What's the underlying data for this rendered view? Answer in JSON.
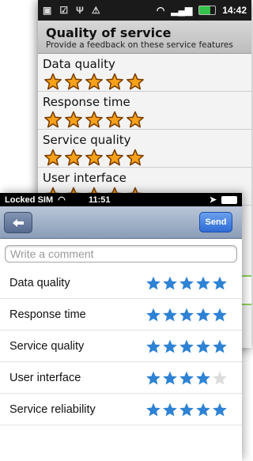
{
  "android": {
    "status": {
      "time": "14:42"
    },
    "header": {
      "title": "Quality of service",
      "subtitle": "Provide a feedback on these service features"
    },
    "items": [
      {
        "label": "Data quality",
        "rating": 5
      },
      {
        "label": "Response time",
        "rating": 5
      },
      {
        "label": "Service quality",
        "rating": 5
      },
      {
        "label": "User interface",
        "rating": 5
      }
    ]
  },
  "ios": {
    "status": {
      "carrier": "Locked SIM",
      "time": "11:51"
    },
    "nav": {
      "send_label": "Send"
    },
    "comment": {
      "placeholder": "Write a comment"
    },
    "items": [
      {
        "label": "Data quality",
        "rating": 5
      },
      {
        "label": "Response time",
        "rating": 5
      },
      {
        "label": "Service quality",
        "rating": 5
      },
      {
        "label": "User interface",
        "rating": 4
      },
      {
        "label": "Service reliability",
        "rating": 5
      }
    ],
    "max_rating": 5
  },
  "colors": {
    "android_star_fill": "#f7a11a",
    "android_star_outline": "#7a3d00",
    "ios_star_fill": "#2e82d4",
    "ios_star_empty": "#dcdcdc",
    "send_button": "#2e6cd6",
    "nav_bar": "#8a9db8"
  },
  "icons": {
    "back": "arrow-left-icon",
    "wifi": "wifi-icon",
    "signal": "signal-icon",
    "battery": "battery-icon",
    "location": "location-arrow-icon",
    "usb": "usb-icon",
    "warning": "warning-icon"
  }
}
